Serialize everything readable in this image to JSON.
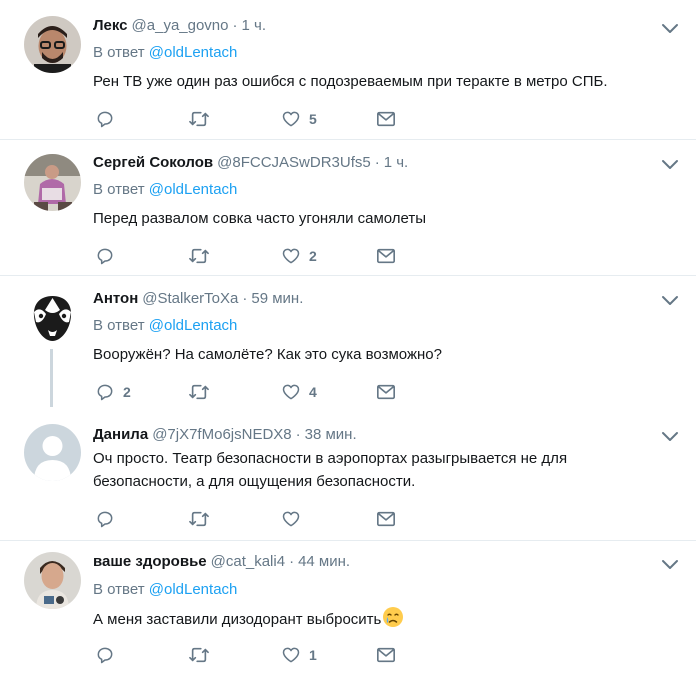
{
  "reply_prefix": "В ответ",
  "tweets": [
    {
      "name": "Лекс",
      "handle": "@a_ya_govno",
      "dot": "·",
      "time": "1 ч.",
      "reply_to": "@oldLentach",
      "text": "Рен ТВ уже один раз ошибся с подозреваемым при теракте в метро СПБ.",
      "replies": "",
      "retweets": "",
      "likes": "5"
    },
    {
      "name": "Сергей Соколов",
      "handle": "@8FCCJASwDR3Ufs5",
      "dot": "·",
      "time": "1 ч.",
      "reply_to": "@oldLentach",
      "text": "Перед развалом совка часто угоняли самолеты",
      "replies": "",
      "retweets": "",
      "likes": "2"
    },
    {
      "name": "Антон",
      "handle": "@StalkerToXa",
      "dot": "·",
      "time": "59 мин.",
      "reply_to": "@oldLentach",
      "text": "Вооружён? На самолёте? Как это сука возможно?",
      "replies": "2",
      "retweets": "",
      "likes": "4"
    },
    {
      "name": "Данила",
      "handle": "@7jX7fMo6jsNEDX8",
      "dot": "·",
      "time": "38 мин.",
      "reply_to": "",
      "text": "Оч просто. Театр безопасности в аэропортах разыгрывается не для безопасности, а для ощущения безопасности.",
      "replies": "",
      "retweets": "",
      "likes": ""
    },
    {
      "name": "ваше здоровье",
      "handle": "@cat_kali4",
      "dot": "·",
      "time": "44 мин.",
      "reply_to": "@oldLentach",
      "text": "А меня заставили дизодорант выбросить",
      "replies": "",
      "retweets": "",
      "likes": "1"
    }
  ],
  "icons": {
    "reply": "reply-icon",
    "retweet": "retweet-icon",
    "like": "heart-icon",
    "dm": "envelope-icon",
    "more": "chevron-down-icon",
    "emoji": "crying-face-emoji"
  },
  "colors": {
    "text": "#14171a",
    "secondary": "#657786",
    "link": "#1da1f2",
    "divider": "#e6ecf0",
    "thread_line": "#ccd6dd"
  }
}
